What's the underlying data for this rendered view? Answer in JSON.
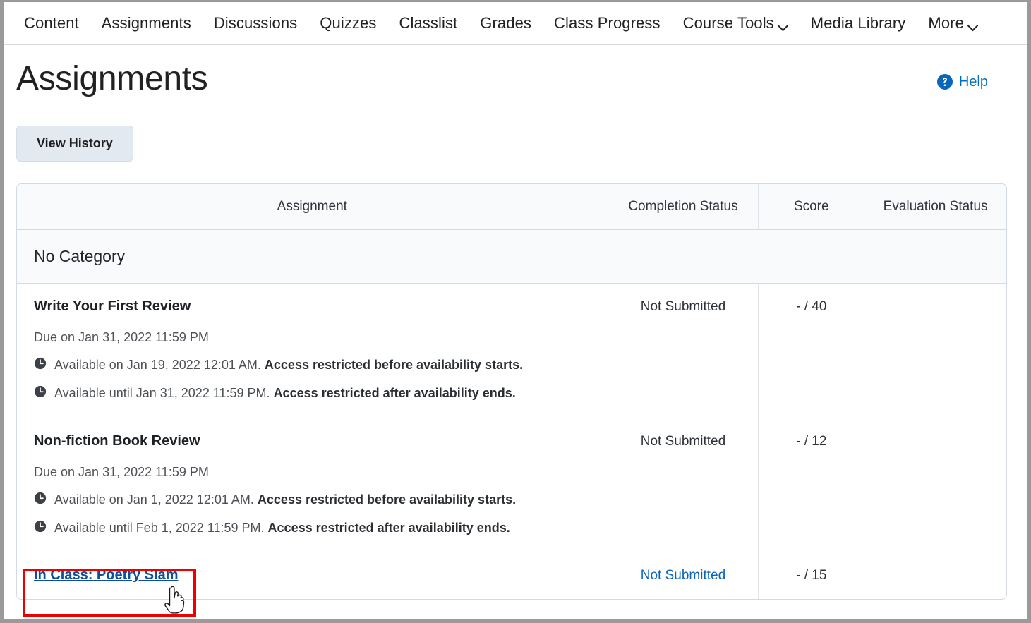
{
  "nav": {
    "items": [
      {
        "label": "Content",
        "has_dropdown": false,
        "icon": ""
      },
      {
        "label": "Assignments",
        "has_dropdown": false,
        "icon": ""
      },
      {
        "label": "Discussions",
        "has_dropdown": false,
        "icon": ""
      },
      {
        "label": "Quizzes",
        "has_dropdown": false,
        "icon": ""
      },
      {
        "label": "Classlist",
        "has_dropdown": false,
        "icon": ""
      },
      {
        "label": "Grades",
        "has_dropdown": false,
        "icon": ""
      },
      {
        "label": "Class Progress",
        "has_dropdown": false,
        "icon": ""
      },
      {
        "label": "Course Tools",
        "has_dropdown": true,
        "icon": "chevron-down-icon"
      },
      {
        "label": "Media Library",
        "has_dropdown": false,
        "icon": ""
      },
      {
        "label": "More",
        "has_dropdown": true,
        "icon": "chevron-down-icon"
      }
    ]
  },
  "page": {
    "title": "Assignments",
    "help_label": "Help",
    "help_icon": "help-circle-icon",
    "view_history_label": "View History"
  },
  "table": {
    "columns": [
      {
        "key": "assignment",
        "label": "Assignment"
      },
      {
        "key": "completion_status",
        "label": "Completion Status"
      },
      {
        "key": "score",
        "label": "Score"
      },
      {
        "key": "evaluation_status",
        "label": "Evaluation Status"
      }
    ],
    "category": "No Category",
    "rows": [
      {
        "name": "Write Your First Review",
        "is_link": false,
        "due": "Due on Jan 31, 2022 11:59 PM",
        "availability": [
          {
            "icon": "clock-icon",
            "text": "Available on Jan 19, 2022 12:01 AM.",
            "restriction": "Access restricted before availability starts."
          },
          {
            "icon": "clock-icon",
            "text": "Available until Jan 31, 2022 11:59 PM.",
            "restriction": "Access restricted after availability ends."
          }
        ],
        "completion_status": "Not Submitted",
        "completion_is_link": false,
        "score": "- / 40",
        "evaluation_status": ""
      },
      {
        "name": "Non-fiction Book Review",
        "is_link": false,
        "due": "Due on Jan 31, 2022 11:59 PM",
        "availability": [
          {
            "icon": "clock-icon",
            "text": "Available on Jan 1, 2022 12:01 AM.",
            "restriction": "Access restricted before availability starts."
          },
          {
            "icon": "clock-icon",
            "text": "Available until Feb 1, 2022 11:59 PM.",
            "restriction": "Access restricted after availability ends."
          }
        ],
        "completion_status": "Not Submitted",
        "completion_is_link": false,
        "score": "- / 12",
        "evaluation_status": ""
      },
      {
        "name": "In Class: Poetry Slam",
        "is_link": true,
        "due": "",
        "availability": [],
        "completion_status": "Not Submitted",
        "completion_is_link": true,
        "score": "- / 15",
        "evaluation_status": ""
      }
    ]
  },
  "annotation": {
    "highlight_color": "#ee0000",
    "highlight_target": "In Class: Poetry Slam",
    "cursor": "pointer-hand-cursor"
  },
  "colors": {
    "link": "#0c4f9e",
    "link_alt": "#0b64b8",
    "help_blue": "#006fbf",
    "button_bg": "#e3e9f1",
    "header_bg": "#f9fafc",
    "border": "#d3dae3",
    "highlight": "#ee0000"
  }
}
